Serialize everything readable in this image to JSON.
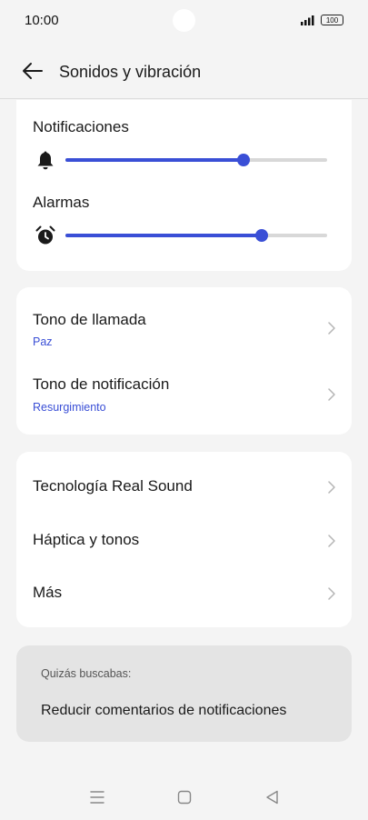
{
  "status_bar": {
    "time": "10:00",
    "battery": "100",
    "signal_icon": "signal-bars-icon"
  },
  "header": {
    "back_icon": "arrow-left-icon",
    "title": "Sonidos y vibración"
  },
  "volume": {
    "notifications": {
      "label": "Notificaciones",
      "icon": "bell-icon",
      "level": 0.68
    },
    "alarms": {
      "label": "Alarmas",
      "icon": "alarm-clock-icon",
      "level": 0.75
    }
  },
  "tones": [
    {
      "title": "Tono de llamada",
      "value": "Paz"
    },
    {
      "title": "Tono de notificación",
      "value": "Resurgimiento"
    }
  ],
  "more": [
    {
      "title": "Tecnología Real Sound"
    },
    {
      "title": "Háptica y tonos"
    },
    {
      "title": "Más"
    }
  ],
  "suggestions": {
    "heading": "Quizás buscabas:",
    "item": "Reducir comentarios de notificaciones"
  },
  "colors": {
    "accent": "#3a4fd6",
    "background": "#f4f4f4",
    "card": "#ffffff",
    "suggestion_card": "#e4e4e4"
  }
}
